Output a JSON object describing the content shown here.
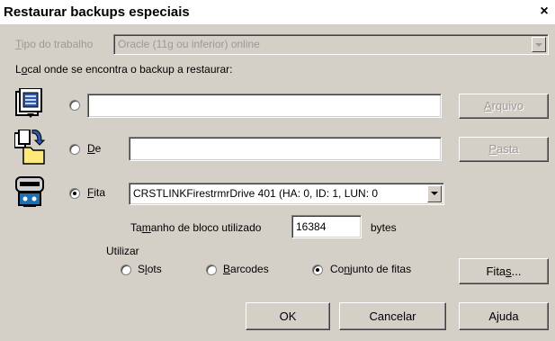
{
  "window": {
    "title": "Restaurar backups especiais",
    "close_glyph": "×"
  },
  "job_type": {
    "label": "Tipo do trabalho",
    "value": "Oracle (11g ou inferior) online"
  },
  "location_label": "Local onde se encontra o backup a restaurar:",
  "file_row": {
    "value": "",
    "button": "Arquivo",
    "icon": "file-icon"
  },
  "folder_row": {
    "radio_label": "De",
    "value": "",
    "button": "Pasta",
    "icon": "folder-icon"
  },
  "tape_row": {
    "radio_label": "Fita",
    "value": "CRSTLINKFirestrmrDrive  401 (HA: 0, ID: 1, LUN: 0",
    "icon": "tape-drive-icon"
  },
  "block_size": {
    "label": "Tamanho de bloco utilizado",
    "value": "16384",
    "unit": "bytes"
  },
  "use_group": {
    "label": "Utilizar",
    "options": [
      "Slots",
      "Barcodes",
      "Conjunto de fitas"
    ],
    "selected": "Conjunto de fitas"
  },
  "buttons": {
    "tapes": "Fitas...",
    "ok": "OK",
    "cancel": "Cancelar",
    "help": "Ajuda"
  },
  "colors": {
    "dialog_bg": "#d4d0c8",
    "disabled_text": "#9c9a94"
  }
}
